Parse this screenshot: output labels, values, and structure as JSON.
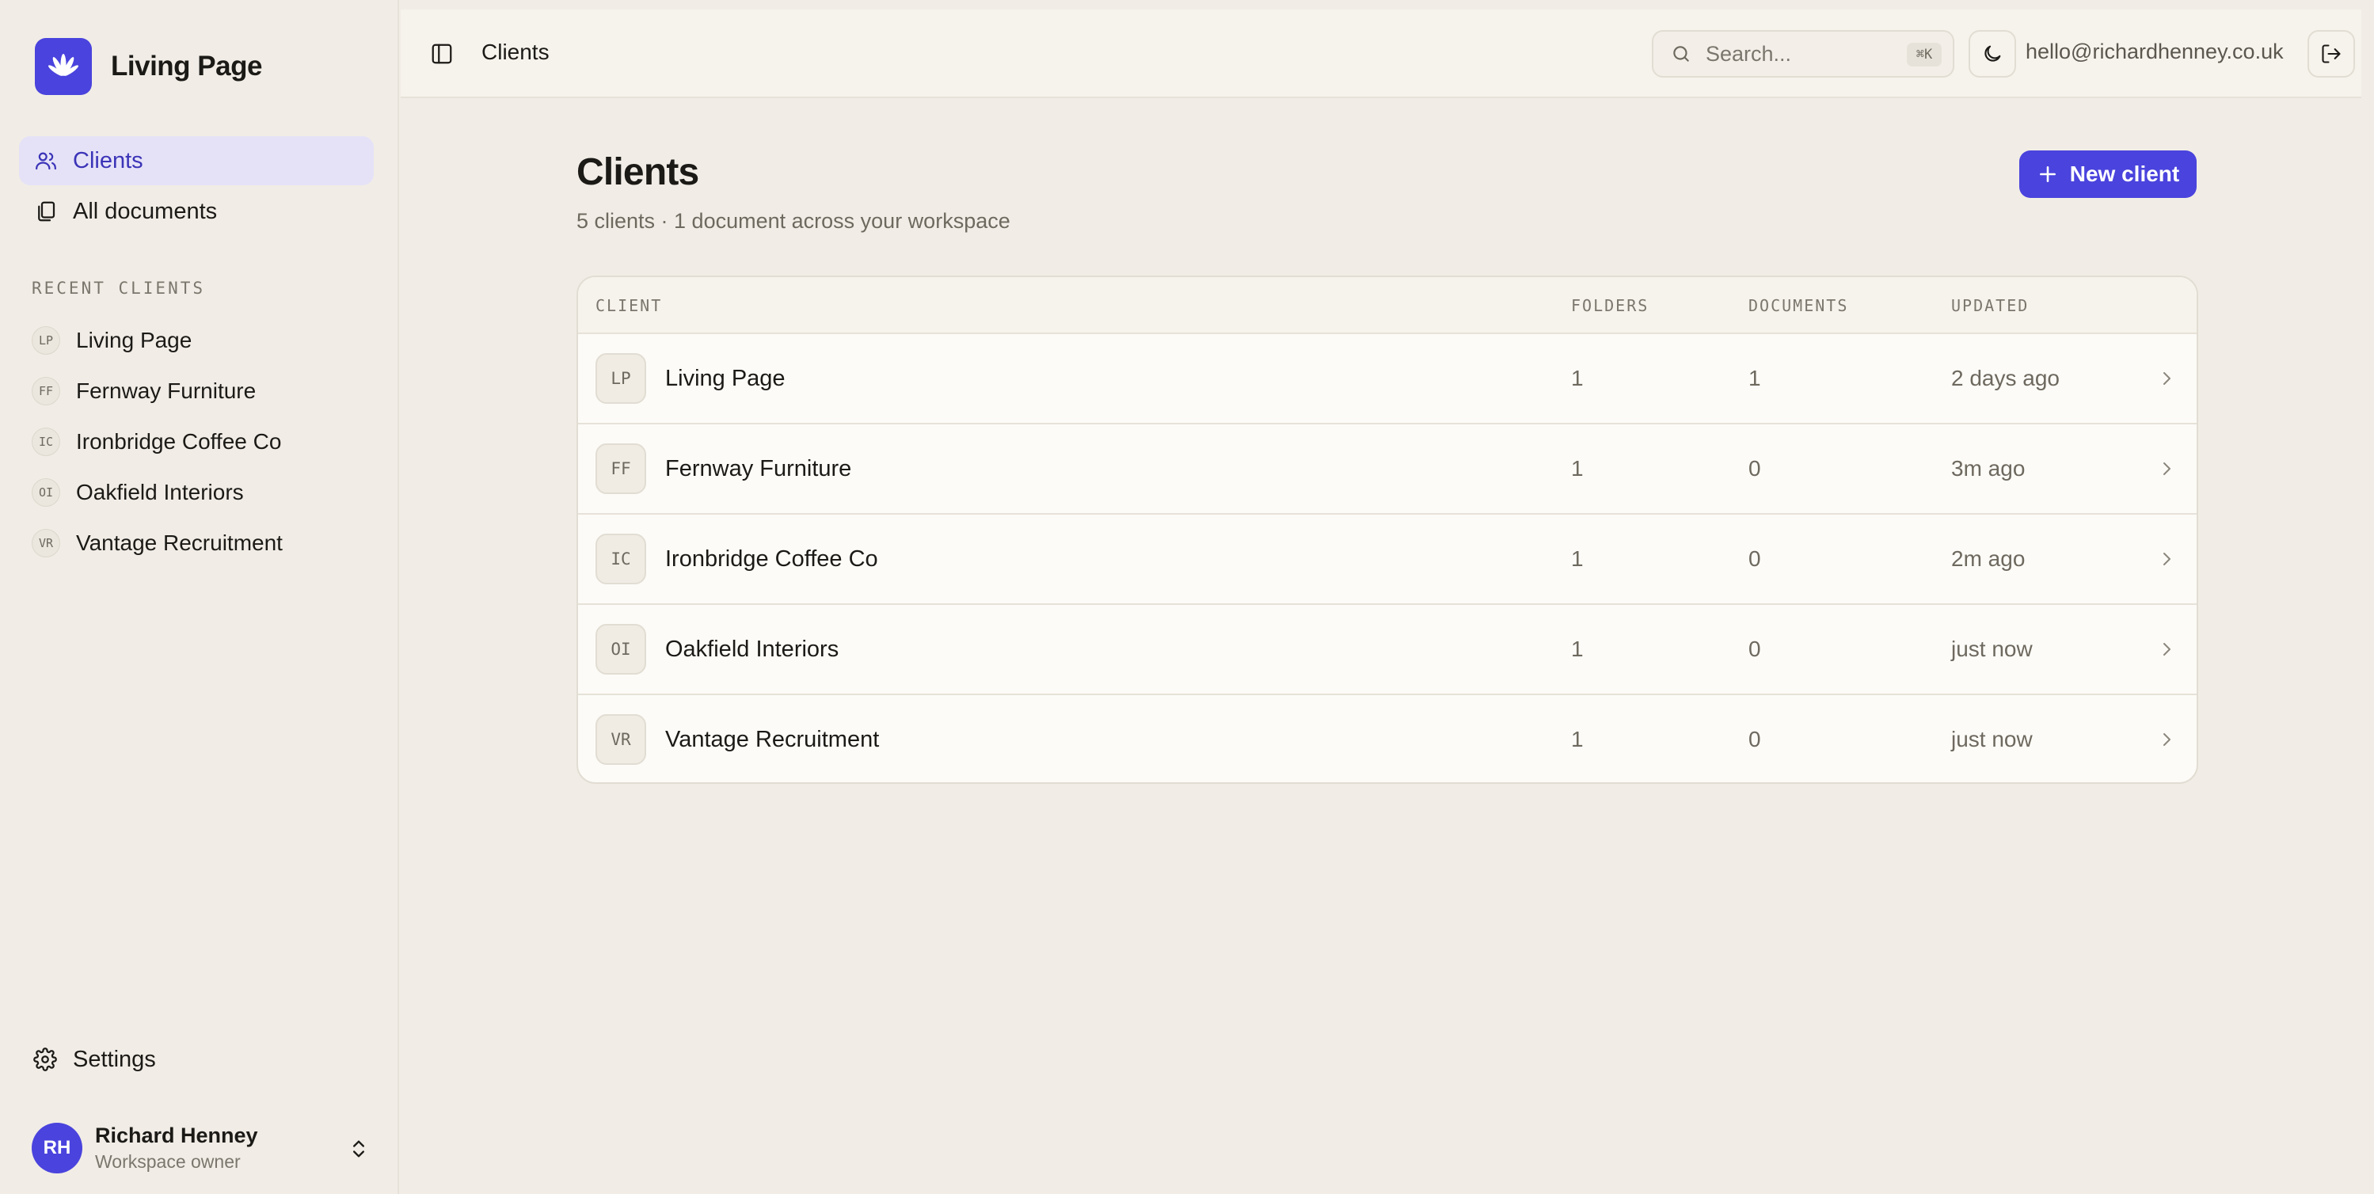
{
  "app": {
    "name": "Living Page"
  },
  "sidebar": {
    "nav": [
      {
        "label": "Clients",
        "icon": "users-icon",
        "active": true
      },
      {
        "label": "All documents",
        "icon": "documents-icon",
        "active": false
      }
    ],
    "recent_label": "RECENT CLIENTS",
    "recent": [
      {
        "initials": "LP",
        "name": "Living Page"
      },
      {
        "initials": "FF",
        "name": "Fernway Furniture"
      },
      {
        "initials": "IC",
        "name": "Ironbridge Coffee Co"
      },
      {
        "initials": "OI",
        "name": "Oakfield Interiors"
      },
      {
        "initials": "VR",
        "name": "Vantage Recruitment"
      }
    ],
    "settings_label": "Settings",
    "user": {
      "initials": "RH",
      "name": "Richard Henney",
      "role": "Workspace owner"
    }
  },
  "topbar": {
    "title": "Clients",
    "search_placeholder": "Search...",
    "search_shortcut": "⌘K",
    "email": "hello@richardhenney.co.uk"
  },
  "main": {
    "title": "Clients",
    "subtitle": "5 clients · 1 document across your workspace",
    "new_button": "New client",
    "table": {
      "headers": {
        "client": "CLIENT",
        "folders": "FOLDERS",
        "documents": "DOCUMENTS",
        "updated": "UPDATED"
      },
      "rows": [
        {
          "initials": "LP",
          "name": "Living Page",
          "folders": "1",
          "documents": "1",
          "updated": "2 days ago"
        },
        {
          "initials": "FF",
          "name": "Fernway Furniture",
          "folders": "1",
          "documents": "0",
          "updated": "3m ago"
        },
        {
          "initials": "IC",
          "name": "Ironbridge Coffee Co",
          "folders": "1",
          "documents": "0",
          "updated": "2m ago"
        },
        {
          "initials": "OI",
          "name": "Oakfield Interiors",
          "folders": "1",
          "documents": "0",
          "updated": "just now"
        },
        {
          "initials": "VR",
          "name": "Vantage Recruitment",
          "folders": "1",
          "documents": "0",
          "updated": "just now"
        }
      ]
    }
  },
  "colors": {
    "accent": "#4a43dd",
    "background": "#f1ede6",
    "active_nav": "#e5e2f7"
  }
}
